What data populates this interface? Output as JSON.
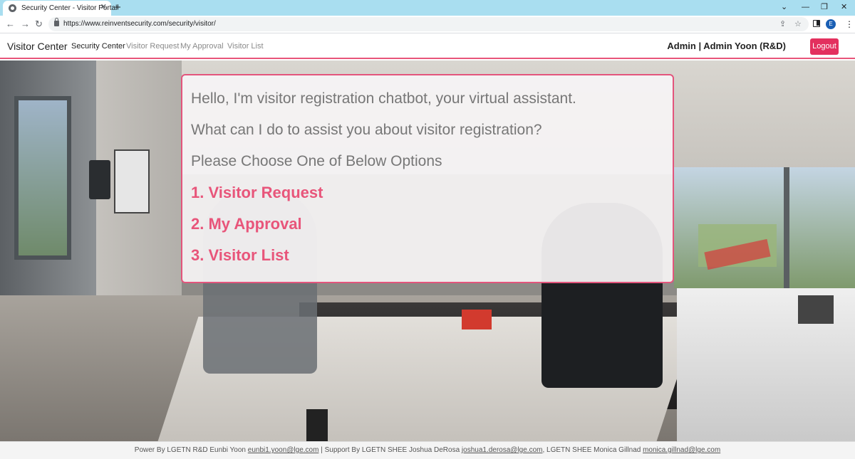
{
  "browser": {
    "tab_title": "Security Center - Visitor Portal",
    "url": "https://www.reinventsecurity.com/security/visitor/",
    "profile_initial": "E"
  },
  "navbar": {
    "brand": "Visitor Center",
    "links": [
      {
        "label": "Security Center"
      },
      {
        "label": "Visitor Request"
      },
      {
        "label": "My Approval"
      },
      {
        "label": "Visitor List"
      }
    ],
    "user": "Admin | Admin Yoon (R&D)",
    "logout_label": "Logout"
  },
  "chat": {
    "greeting": "Hello, I'm visitor registration chatbot, your virtual assistant.",
    "question": "What can I do to assist you about visitor registration?",
    "prompt": "Please Choose One of Below Options",
    "options": [
      "1. Visitor Request",
      "2. My Approval",
      "3. Visitor List"
    ]
  },
  "footer": {
    "power_prefix": "Power By LGETN R&D Eunbi Yoon",
    "power_email": "eunbi1.yoon@lge.com",
    "support_prefix": " | Support By LGETN SHEE Joshua DeRosa",
    "support_email1": "joshua1.derosa@lge.com",
    "support_mid": ", LGETN SHEE Monica Gillnad",
    "support_email2": "monica.gillnad@lge.com"
  },
  "colors": {
    "accent": "#e8557a",
    "logout_bg": "#e3305e",
    "titlebar": "#a9def0"
  }
}
